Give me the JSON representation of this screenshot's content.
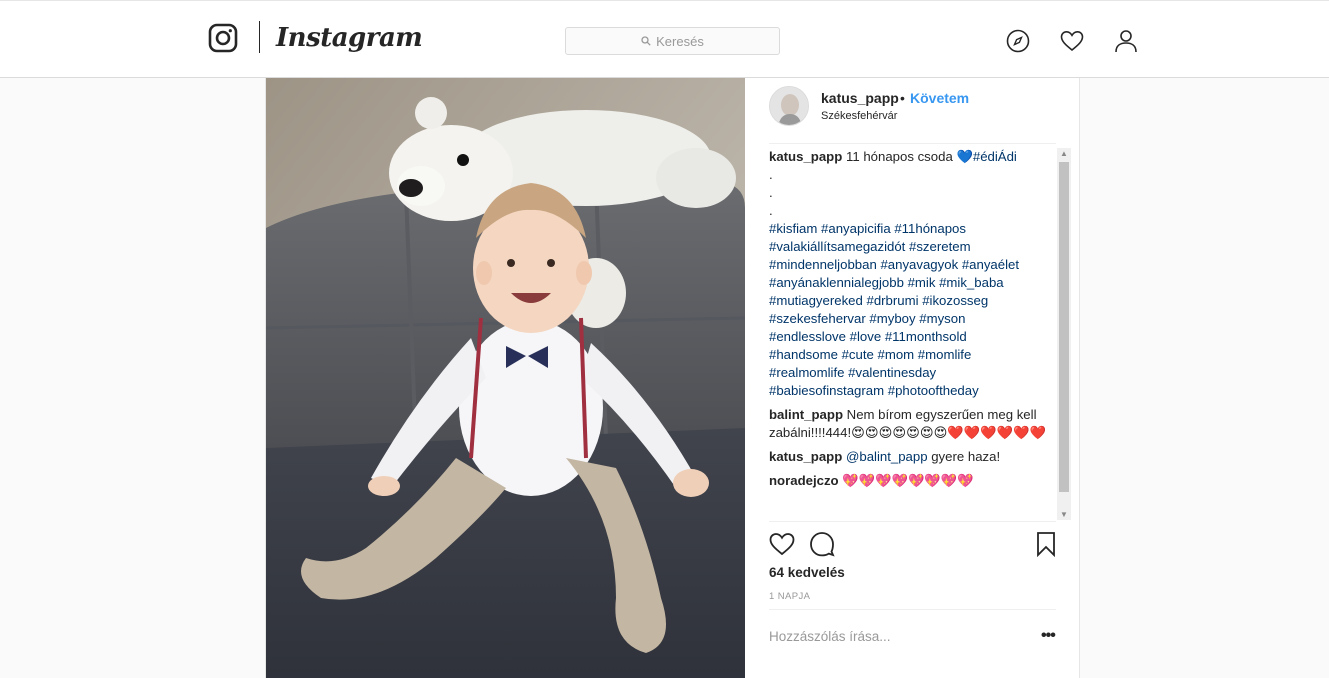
{
  "nav": {
    "logo_text": "Instagram",
    "search_placeholder": "Keresés",
    "icons": [
      "camera-logo-icon",
      "explore-icon",
      "heart-icon",
      "profile-icon"
    ]
  },
  "post": {
    "author": "katus_papp",
    "follow_label": "Követem",
    "location": "Székesfehérvár",
    "caption": {
      "user": "katus_papp",
      "text": "11 hónapos csoda 💙",
      "inline_tag": "#édiÁdi",
      "dots": [
        ".",
        ".",
        "."
      ],
      "tag_lines": [
        "#kisfiam #anyapicifia #11hónapos",
        "#valakiállítsamegazidót #szeretem",
        "#mindenneljobban #anyavagyok #anyaélet",
        "#anyánaklennialegjobb #mik #mik_baba",
        "#mutiagyereked #drbrumi #ikozosseg",
        "#szekesfehervar #myboy #myson",
        "#endlesslove #love #11monthsold",
        "#handsome #cute #mom #momlife",
        "#realmomlife #valentinesday",
        "#babiesofinstagram #photooftheday"
      ]
    },
    "comments": [
      {
        "user": "balint_papp",
        "text": "Nem bírom egyszerűen meg kell zabálni!!!!444!😍😍😍😍😍😍😍❤️❤️❤️❤️❤️❤️"
      },
      {
        "user": "katus_papp",
        "mention": "@balint_papp",
        "text": " gyere haza!"
      },
      {
        "user": "noradejczo",
        "text": "💖💖💖💖💖💖💖💖"
      }
    ],
    "likes": "64 kedvelés",
    "time": "1 NAPJA",
    "add_comment_placeholder": "Hozzászólás írása...",
    "more_label": "•••"
  },
  "colors": {
    "link_blue": "#3897f0",
    "hashtag": "#003569",
    "border": "#dbdbdb"
  }
}
